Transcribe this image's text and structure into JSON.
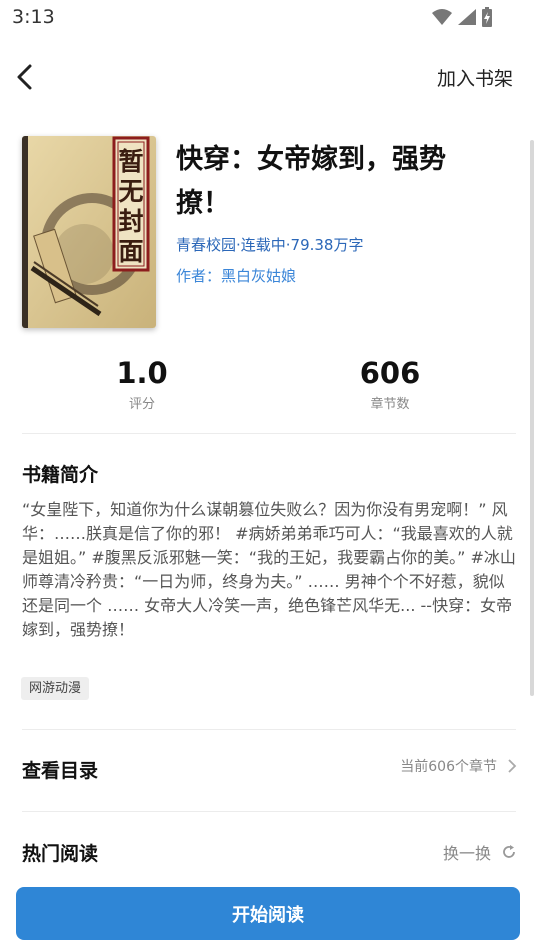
{
  "status_bar": {
    "time": "3:13"
  },
  "header": {
    "add_to_shelf": "加入书架"
  },
  "book": {
    "cover_text": "暂无封面",
    "title": "快穿：女帝嫁到，强势撩！",
    "meta": "青春校园·连载中·79.38万字",
    "author": "作者：黑白灰姑娘"
  },
  "stats": {
    "rating": {
      "value": "1.0",
      "label": "评分"
    },
    "chapters": {
      "value": "606",
      "label": "章节数"
    }
  },
  "intro": {
    "heading": "书籍简介",
    "text": "“女皇陛下，知道你为什么谋朝篡位失败么？因为你没有男宠啊！” 风华：……朕真是信了你的邪！ #病娇弟弟乖巧可人：“我最喜欢的人就是姐姐。” #腹黑反派邪魅一笑：“我的王妃，我要霸占你的美。” #冰山师尊清冷矜贵：“一日为师，终身为夫。” …… 男神个个不好惹，貌似还是同一个 …… 女帝大人冷笑一声，绝色锋芒风华无... --快穿：女帝嫁到，强势撩！",
    "tag": "网游动漫"
  },
  "catalog": {
    "label": "查看目录",
    "current": "当前606个章节"
  },
  "hot": {
    "label": "热门阅读",
    "refresh": "换一换"
  },
  "start_button": "开始阅读",
  "colors": {
    "accent": "#2f86d6",
    "link": "#2b67b8"
  }
}
